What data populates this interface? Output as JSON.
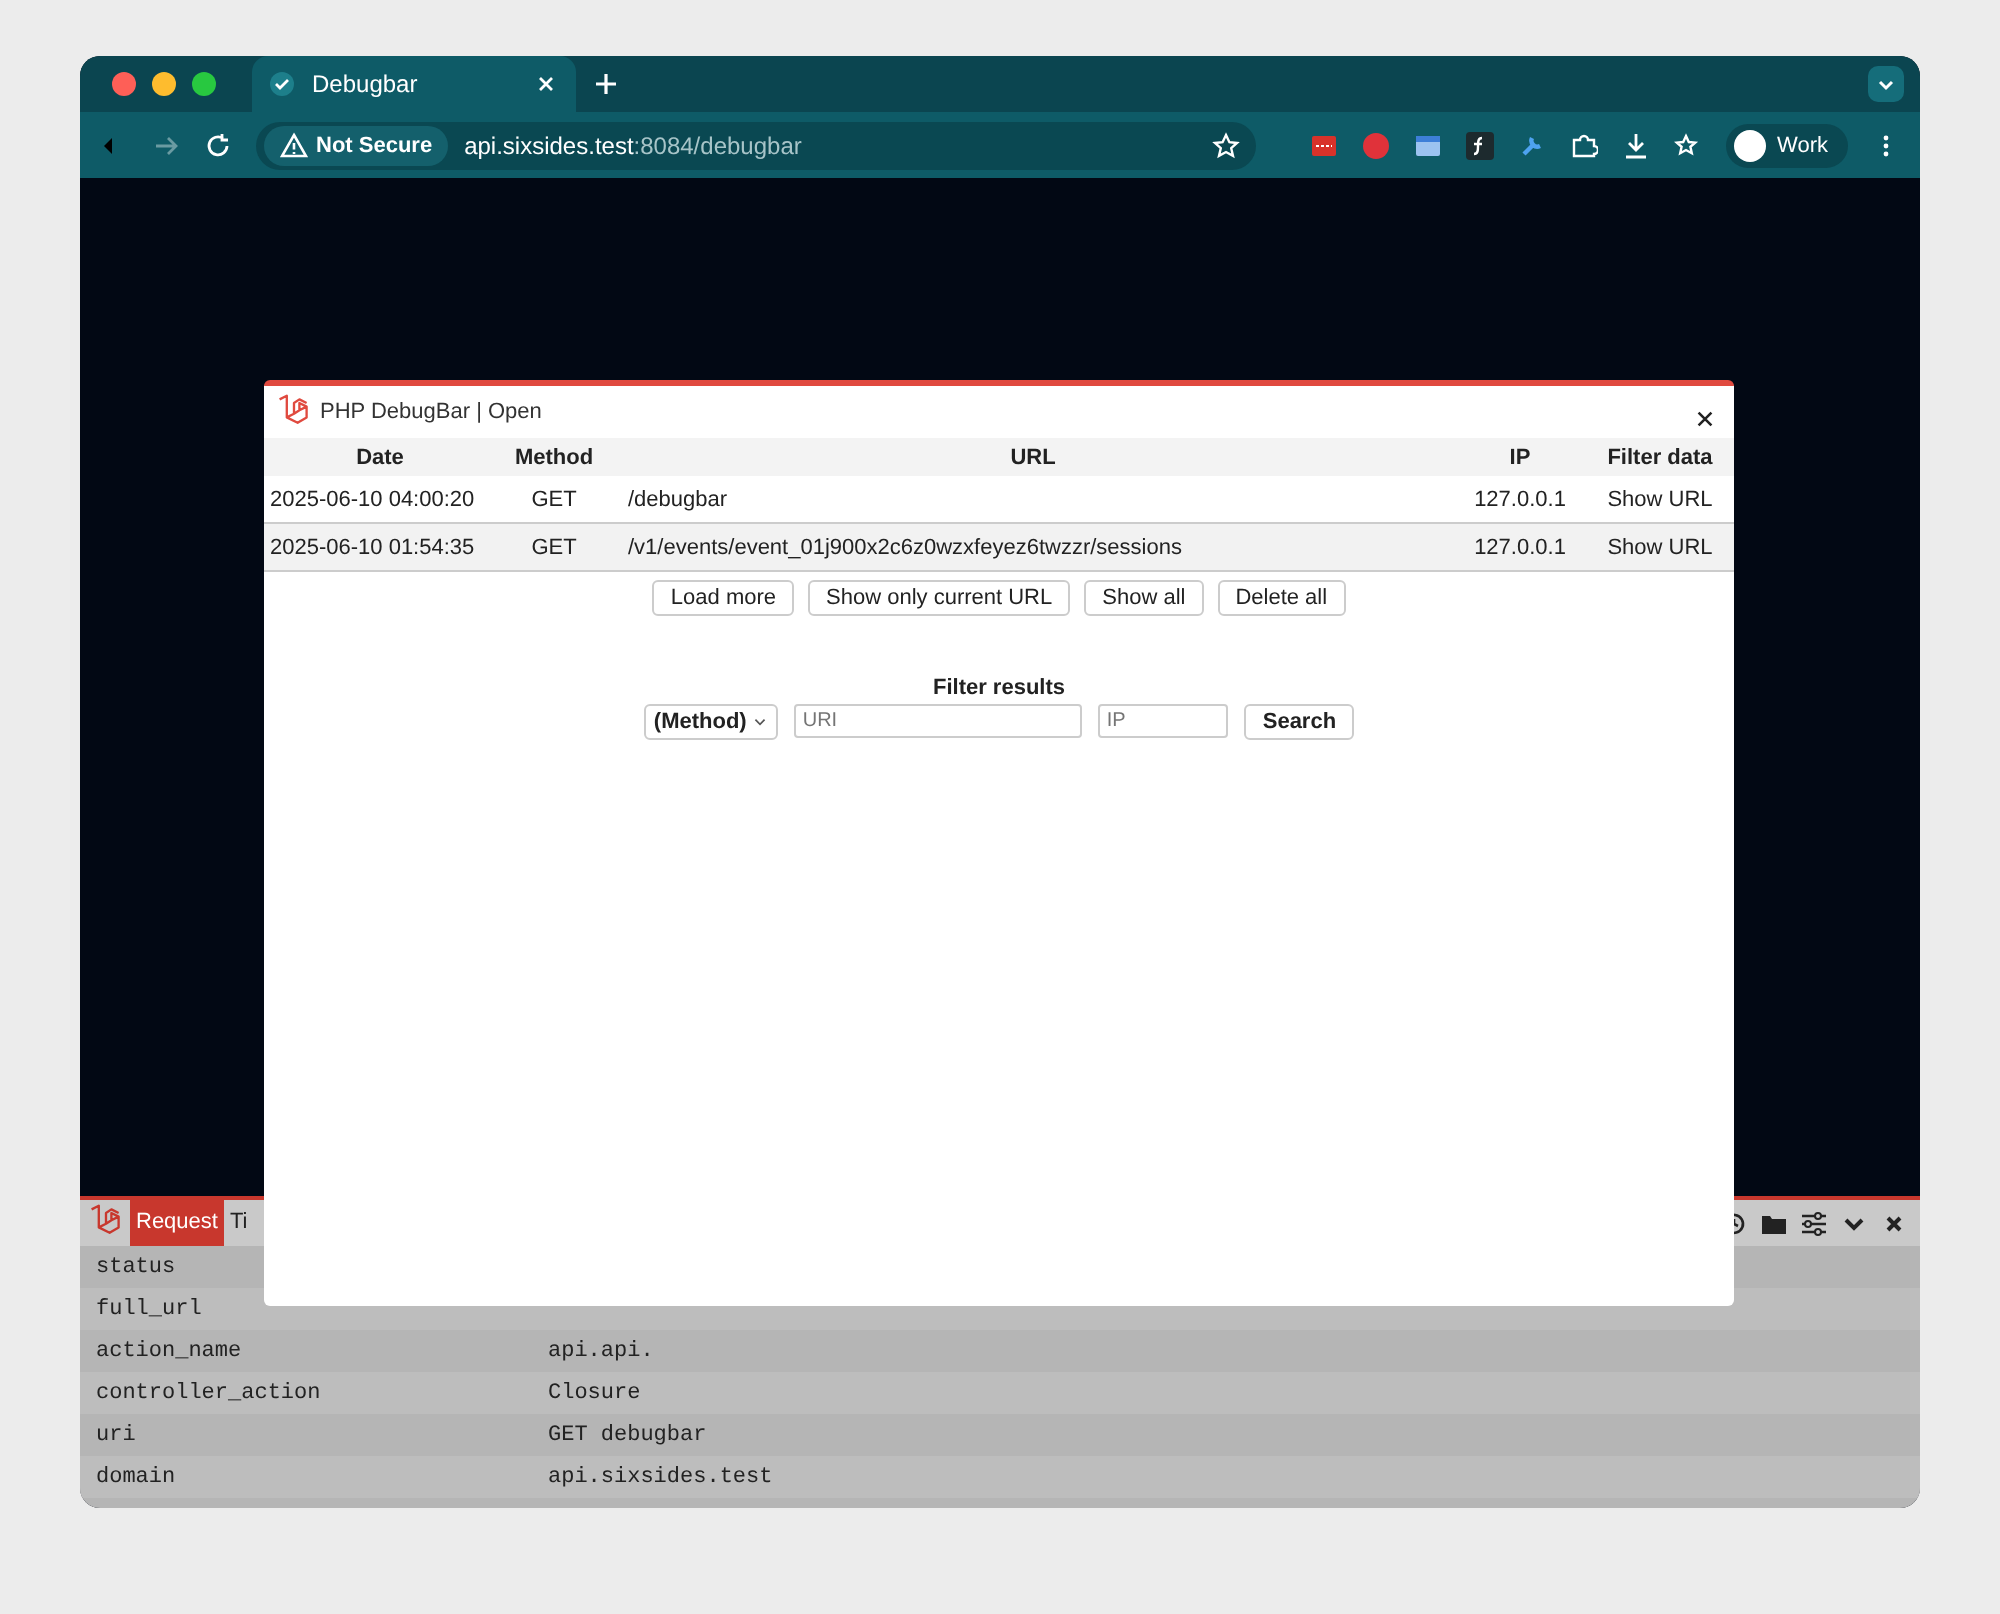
{
  "browser": {
    "tab": {
      "title": "Debugbar"
    },
    "address": {
      "security": "Not Secure",
      "host": "api.sixsides.test",
      "path": ":8084/debugbar"
    },
    "profile": "Work"
  },
  "debugbar": {
    "tabs": [
      {
        "label": "Request",
        "selected": true
      },
      {
        "label": "Ti",
        "selected": false
      }
    ],
    "rows": [
      {
        "key": "status"
      },
      {
        "key": "full_url"
      },
      {
        "key": "action_name",
        "value": "api.api."
      },
      {
        "key": "controller_action",
        "value": "Closure"
      },
      {
        "key": "uri",
        "value": "GET debugbar"
      },
      {
        "key": "domain",
        "value": "api.sixsides.test"
      }
    ]
  },
  "modal": {
    "title": "PHP DebugBar | Open",
    "columns": [
      "Date",
      "Method",
      "URL",
      "IP",
      "Filter data"
    ],
    "rows": [
      {
        "date": "2025-06-10 04:00:20",
        "method": "GET",
        "url": "/debugbar",
        "ip": "127.0.0.1",
        "action": "Show URL"
      },
      {
        "date": "2025-06-10 01:54:35",
        "method": "GET",
        "url": "/v1/events/event_01j900x2c6z0wzxfeyez6twzzr/sessions",
        "ip": "127.0.0.1",
        "action": "Show URL"
      }
    ],
    "buttons": [
      "Load more",
      "Show only current URL",
      "Show all",
      "Delete all"
    ],
    "filter": {
      "title": "Filter results",
      "method": "(Method)",
      "uri_placeholder": "URI",
      "ip_placeholder": "IP",
      "search": "Search"
    }
  }
}
